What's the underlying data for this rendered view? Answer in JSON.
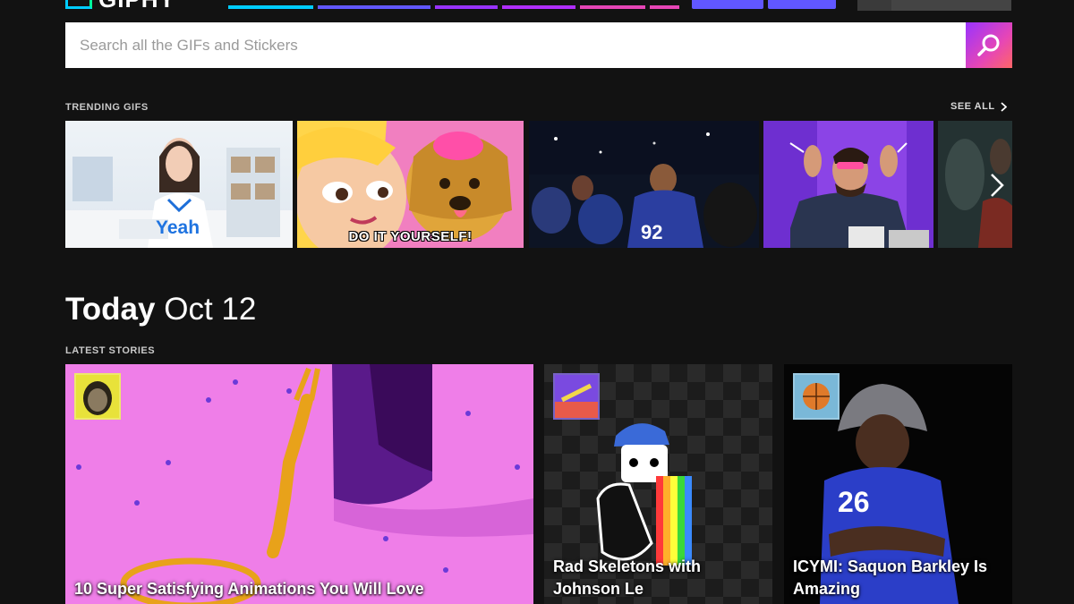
{
  "header": {
    "logo_text": "GIPHY",
    "nav_colors": [
      "#00ccff",
      "#6157ff",
      "#9933ff",
      "#b02eff",
      "#e646b6",
      "#ff4fd1"
    ]
  },
  "search": {
    "placeholder": "Search all the GIFs and Stickers",
    "icon": "search-icon"
  },
  "trending": {
    "label": "TRENDING GIFS",
    "see_all": "SEE ALL",
    "items": [
      {
        "caption": "Yeah"
      },
      {
        "caption": "DO IT YOURSELF!"
      },
      {
        "caption": ""
      },
      {
        "caption": ""
      },
      {
        "caption": ""
      }
    ]
  },
  "today": {
    "day": "Today",
    "date": "Oct 12"
  },
  "stories": {
    "label": "LATEST STORIES",
    "items": [
      {
        "title": "10 Super Satisfying Animations You Will Love"
      },
      {
        "title": "Rad Skeletons with Johnson Le"
      },
      {
        "title": "ICYMI: Saquon Barkley Is Amazing"
      }
    ]
  }
}
